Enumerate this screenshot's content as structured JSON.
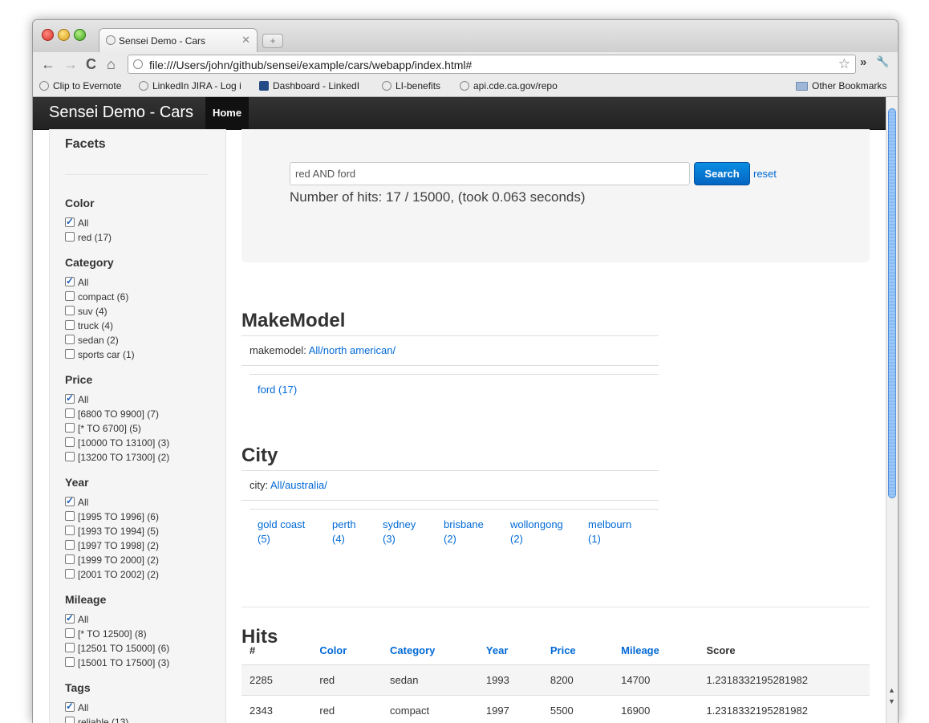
{
  "browser": {
    "tab_title": "Sensei Demo - Cars",
    "close_glyph": "✕",
    "new_tab_glyph": "+",
    "url": "file:///Users/john/github/sensei/example/cars/webapp/index.html#",
    "back_glyph": "←",
    "forward_glyph": "→",
    "reload_glyph": "C",
    "home_glyph": "⌂",
    "star_glyph": "☆",
    "more_glyph": "»",
    "wrench_glyph": "🔧",
    "bookmarks": [
      "Clip to Evernote",
      "LinkedIn JIRA - Log i",
      "Dashboard - LinkedI",
      "LI-benefits",
      "api.cde.ca.gov/repo"
    ],
    "other_bookmarks": "Other Bookmarks"
  },
  "navbar": {
    "brand": "Sensei Demo - Cars",
    "home": "Home"
  },
  "sidebar": {
    "title": "Facets",
    "groups": [
      {
        "name": "Color",
        "options": [
          {
            "label": "All",
            "checked": true
          },
          {
            "label": "red (17)",
            "checked": false
          }
        ]
      },
      {
        "name": "Category",
        "options": [
          {
            "label": "All",
            "checked": true
          },
          {
            "label": "compact (6)",
            "checked": false
          },
          {
            "label": "suv (4)",
            "checked": false
          },
          {
            "label": "truck (4)",
            "checked": false
          },
          {
            "label": "sedan (2)",
            "checked": false
          },
          {
            "label": "sports car (1)",
            "checked": false
          }
        ]
      },
      {
        "name": "Price",
        "options": [
          {
            "label": "All",
            "checked": true
          },
          {
            "label": "[6800 TO 9900] (7)",
            "checked": false
          },
          {
            "label": "[* TO 6700] (5)",
            "checked": false
          },
          {
            "label": "[10000 TO 13100] (3)",
            "checked": false
          },
          {
            "label": "[13200 TO 17300] (2)",
            "checked": false
          }
        ]
      },
      {
        "name": "Year",
        "options": [
          {
            "label": "All",
            "checked": true
          },
          {
            "label": "[1995 TO 1996] (6)",
            "checked": false
          },
          {
            "label": "[1993 TO 1994] (5)",
            "checked": false
          },
          {
            "label": "[1997 TO 1998] (2)",
            "checked": false
          },
          {
            "label": "[1999 TO 2000] (2)",
            "checked": false
          },
          {
            "label": "[2001 TO 2002] (2)",
            "checked": false
          }
        ]
      },
      {
        "name": "Mileage",
        "options": [
          {
            "label": "All",
            "checked": true
          },
          {
            "label": "[* TO 12500] (8)",
            "checked": false
          },
          {
            "label": "[12501 TO 15000] (6)",
            "checked": false
          },
          {
            "label": "[15001 TO 17500] (3)",
            "checked": false
          }
        ]
      },
      {
        "name": "Tags",
        "options": [
          {
            "label": "All",
            "checked": true
          },
          {
            "label": "reliable (13)",
            "checked": false
          }
        ]
      }
    ]
  },
  "search": {
    "query": "red AND ford",
    "button": "Search",
    "reset": "reset",
    "summary": "Number of hits: 17 / 15000, (took 0.063 seconds)"
  },
  "makemodel": {
    "heading": "MakeModel",
    "crumb_label": "makemodel: ",
    "crumb_link": "All/north american/",
    "items": [
      {
        "name": "ford",
        "count": "(17)"
      }
    ]
  },
  "city": {
    "heading": "City",
    "crumb_label": "city: ",
    "crumb_link": "All/australia/",
    "items": [
      {
        "name": "gold coast",
        "count": "(5)"
      },
      {
        "name": "perth",
        "count": "(4)"
      },
      {
        "name": "sydney",
        "count": "(3)"
      },
      {
        "name": "brisbane",
        "count": "(2)"
      },
      {
        "name": "wollongong",
        "count": "(2)"
      },
      {
        "name": "melbourn",
        "count": "(1)"
      }
    ]
  },
  "hits": {
    "heading": "Hits",
    "columns": [
      "#",
      "Color",
      "Category",
      "Year",
      "Price",
      "Mileage",
      "Score"
    ],
    "rows": [
      [
        "2285",
        "red",
        "sedan",
        "1993",
        "8200",
        "14700",
        "1.2318332195281982"
      ],
      [
        "2343",
        "red",
        "compact",
        "1997",
        "5500",
        "16900",
        "1.2318332195281982"
      ]
    ]
  }
}
